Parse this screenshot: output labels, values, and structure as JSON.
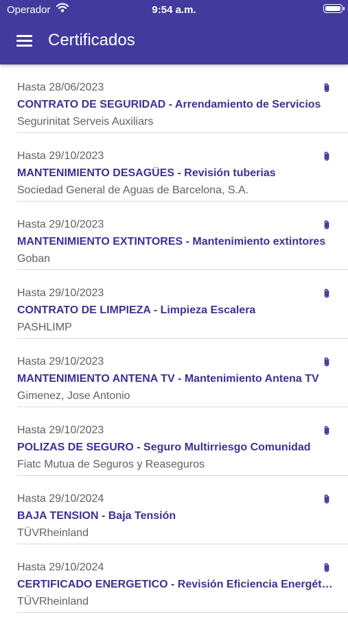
{
  "status_bar": {
    "carrier": "Operador",
    "time": "9:54 a.m."
  },
  "header": {
    "title": "Certificados",
    "menu_icon": "hamburger-menu-icon",
    "background": "#433a9e"
  },
  "colors": {
    "accent": "#3b3295",
    "secondary_text": "#616161",
    "divider": "#d9d9d9"
  },
  "certificates": [
    {
      "date": "Hasta 28/06/2023",
      "title": "CONTRATO DE SEGURIDAD - Arrendamiento de Servicios",
      "company": "Segurinitat Serveis Auxiliars",
      "icon": "paperclip-icon"
    },
    {
      "date": "Hasta 29/10/2023",
      "title": "MANTENIMIENTO DESAGÜES - Revisión tuberias",
      "company": "Sociedad General de Aguas de Barcelona, S.A.",
      "icon": "paperclip-icon"
    },
    {
      "date": "Hasta 29/10/2023",
      "title": "MANTENIMIENTO EXTINTORES - Mantenimiento extintores",
      "company": "Goban",
      "icon": "paperclip-icon"
    },
    {
      "date": "Hasta 29/10/2023",
      "title": "CONTRATO DE LIMPIEZA - Limpieza Escalera",
      "company": "PASHLIMP",
      "icon": "paperclip-icon"
    },
    {
      "date": "Hasta 29/10/2023",
      "title": "MANTENIMIENTO ANTENA TV - Mantenimiento Antena TV",
      "company": "Gimenez, Jose Antonio",
      "icon": "paperclip-icon"
    },
    {
      "date": "Hasta 29/10/2023",
      "title": "POLIZAS DE SEGURO - Seguro Multirriesgo Comunidad",
      "company": "Fiatc Mutua de Seguros y Reaseguros",
      "icon": "paperclip-icon"
    },
    {
      "date": "Hasta 29/10/2024",
      "title": "BAJA TENSION - Baja Tensión",
      "company": "TÜVRheinland",
      "icon": "paperclip-icon"
    },
    {
      "date": "Hasta 29/10/2024",
      "title": "CERTIFICADO ENERGETICO - Revisión Eficiencia Energética",
      "company": "TÜVRheinland",
      "icon": "paperclip-icon"
    }
  ]
}
